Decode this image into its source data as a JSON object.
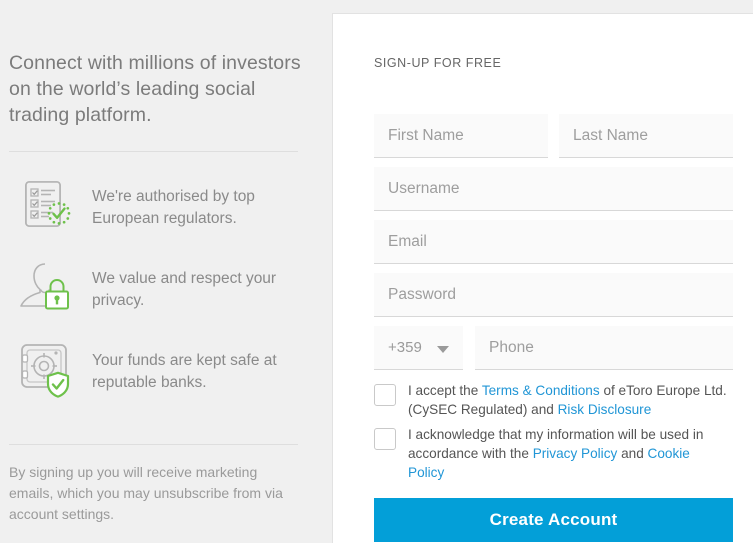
{
  "left": {
    "headline": "Connect with millions of investors on the world’s leading social trading platform.",
    "features": [
      {
        "icon": "checklist-eu-icon",
        "text": "We're authorised by top European regulators."
      },
      {
        "icon": "person-lock-icon",
        "text": "We value and respect your privacy."
      },
      {
        "icon": "safe-shield-icon",
        "text": "Your funds are kept safe at reputable banks."
      }
    ],
    "footnote": "By signing up you will receive marketing emails, which you may unsubscribe from via account settings."
  },
  "form": {
    "title": "SIGN-UP FOR FREE",
    "first_name": {
      "placeholder": "First Name",
      "value": ""
    },
    "last_name": {
      "placeholder": "Last Name",
      "value": ""
    },
    "username": {
      "placeholder": "Username",
      "value": ""
    },
    "email": {
      "placeholder": "Email",
      "value": ""
    },
    "password": {
      "placeholder": "Password",
      "value": ""
    },
    "country_code": {
      "value": "+359",
      "caret": "chevron-down-icon"
    },
    "phone": {
      "placeholder": "Phone",
      "value": ""
    },
    "terms": {
      "checked": false,
      "prefix": "I accept the ",
      "link1": "Terms & Conditions",
      "middle": " of eToro Europe Ltd. (CySEC Regulated) and ",
      "link2": "Risk Disclosure",
      "suffix": ""
    },
    "privacy": {
      "checked": false,
      "prefix": "I acknowledge that my information will be used in accordance with the ",
      "link1": "Privacy Policy",
      "middle": " and ",
      "link2": "Cookie Policy",
      "suffix": ""
    },
    "submit_label": "Create Account"
  },
  "colors": {
    "accent": "#039fd8",
    "link": "#2196d6",
    "green": "#6ec14b",
    "page_bg": "#f0f0f0",
    "card_bg": "#ffffff",
    "field_bg": "#fafafa"
  }
}
